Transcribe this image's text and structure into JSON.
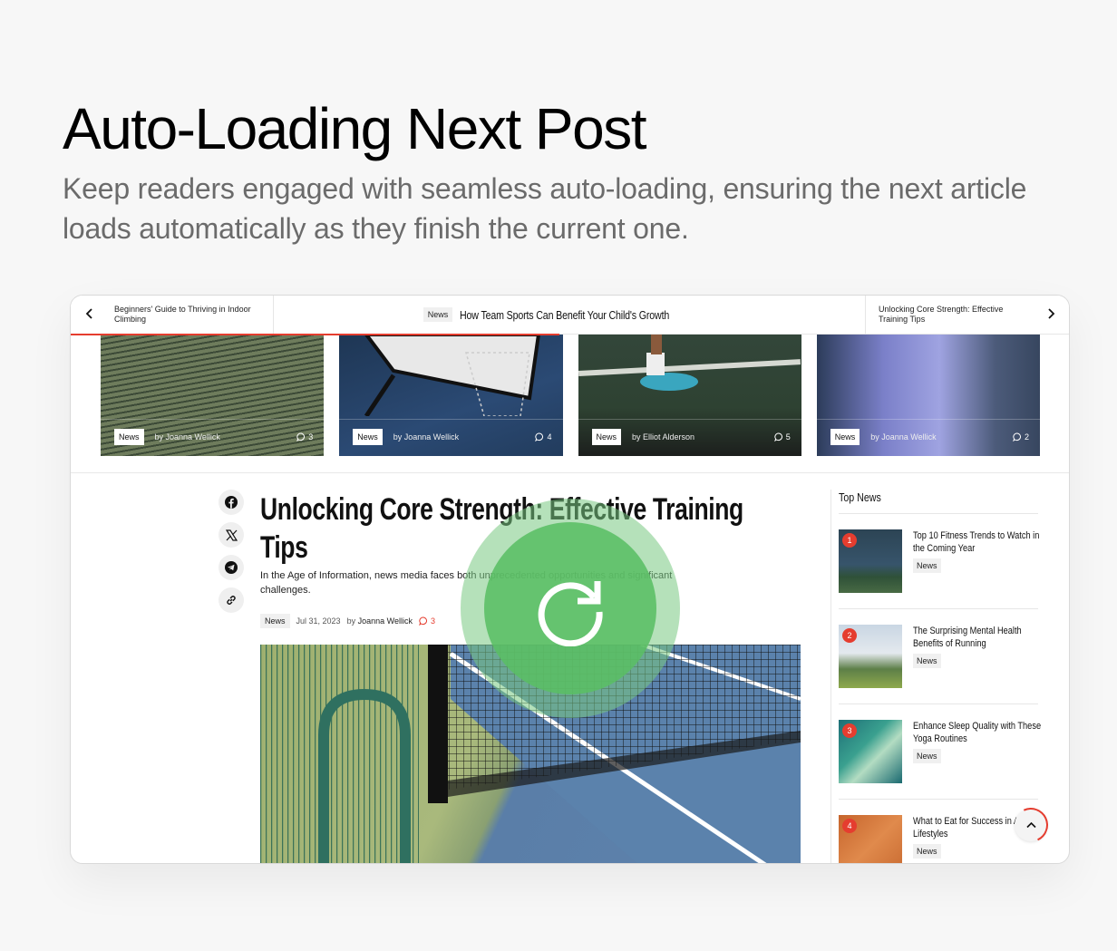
{
  "hero": {
    "title": "Auto-Loading Next Post",
    "subtitle": "Keep readers engaged with seamless auto-loading, ensuring the next article loads automatically as they finish the current one."
  },
  "post_nav": {
    "prev_label": "Beginners' Guide to Thriving in Indoor Climbing",
    "current_tag": "News",
    "current_title": "How Team Sports Can Benefit Your Child's Growth",
    "next_label": "Unlocking Core Strength: Effective Training Tips",
    "reading_progress": 0.49
  },
  "cards": [
    {
      "tag": "News",
      "author": "by Joanna Wellick",
      "comments": "3"
    },
    {
      "tag": "News",
      "author": "by Joanna Wellick",
      "comments": "4"
    },
    {
      "tag": "News",
      "author": "by Elliot Alderson",
      "comments": "5"
    },
    {
      "tag": "News",
      "author": "by Joanna Wellick",
      "comments": "2"
    }
  ],
  "share": [
    "facebook-icon",
    "x-icon",
    "telegram-icon",
    "link-icon"
  ],
  "article": {
    "title": "Unlocking Core Strength: Effective Training Tips",
    "excerpt": "In the Age of Information, news media faces both unprecedented opportunities and significant challenges.",
    "tag": "News",
    "date": "Jul 31, 2023",
    "by": "by",
    "author": "Joanna Wellick",
    "comments": "3"
  },
  "sidebar": {
    "heading": "Top News",
    "items": [
      {
        "rank": "1",
        "title": "Top 10 Fitness Trends to Watch in the Coming Year",
        "tag": "News"
      },
      {
        "rank": "2",
        "title": "The Surprising Mental Health Benefits of Running",
        "tag": "News"
      },
      {
        "rank": "3",
        "title": "Enhance Sleep Quality with These Yoga Routines",
        "tag": "News"
      },
      {
        "rank": "4",
        "title": "What to Eat for Success in Active Lifestyles",
        "tag": "News"
      }
    ]
  },
  "colors": {
    "accent": "#e53d2f",
    "loader": "#5dbf6a"
  }
}
